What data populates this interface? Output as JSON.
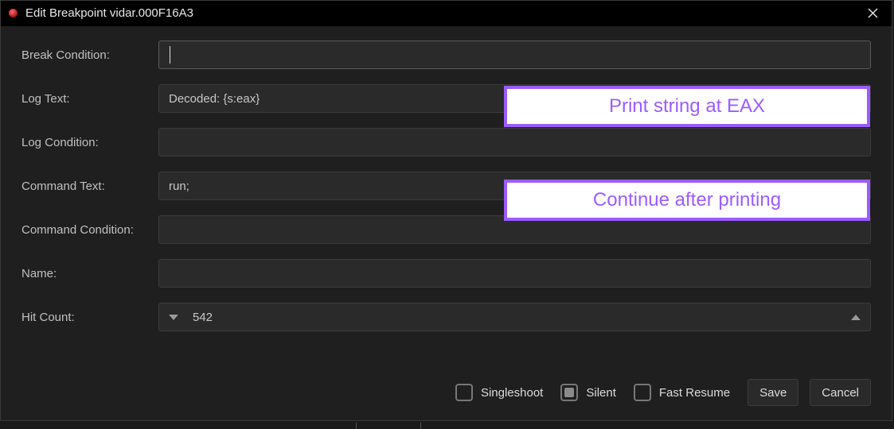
{
  "window": {
    "title": "Edit Breakpoint vidar.000F16A3"
  },
  "fields": {
    "break_condition": {
      "label": "Break Condition:",
      "value": ""
    },
    "log_text": {
      "label": "Log Text:",
      "value": "Decoded: {s:eax}"
    },
    "log_condition": {
      "label": "Log Condition:",
      "value": ""
    },
    "command_text": {
      "label": "Command Text:",
      "value": "run;"
    },
    "command_condition": {
      "label": "Command Condition:",
      "value": ""
    },
    "name": {
      "label": "Name:",
      "value": ""
    },
    "hit_count": {
      "label": "Hit Count:",
      "value": "542"
    }
  },
  "checkboxes": {
    "singleshoot": {
      "label": "Singleshoot",
      "checked": false
    },
    "silent": {
      "label": "Silent",
      "checked": true
    },
    "fast_resume": {
      "label": "Fast Resume",
      "checked": false
    }
  },
  "buttons": {
    "save": "Save",
    "cancel": "Cancel"
  },
  "annotations": {
    "a1": "Print string at EAX",
    "a2": "Continue after printing"
  }
}
